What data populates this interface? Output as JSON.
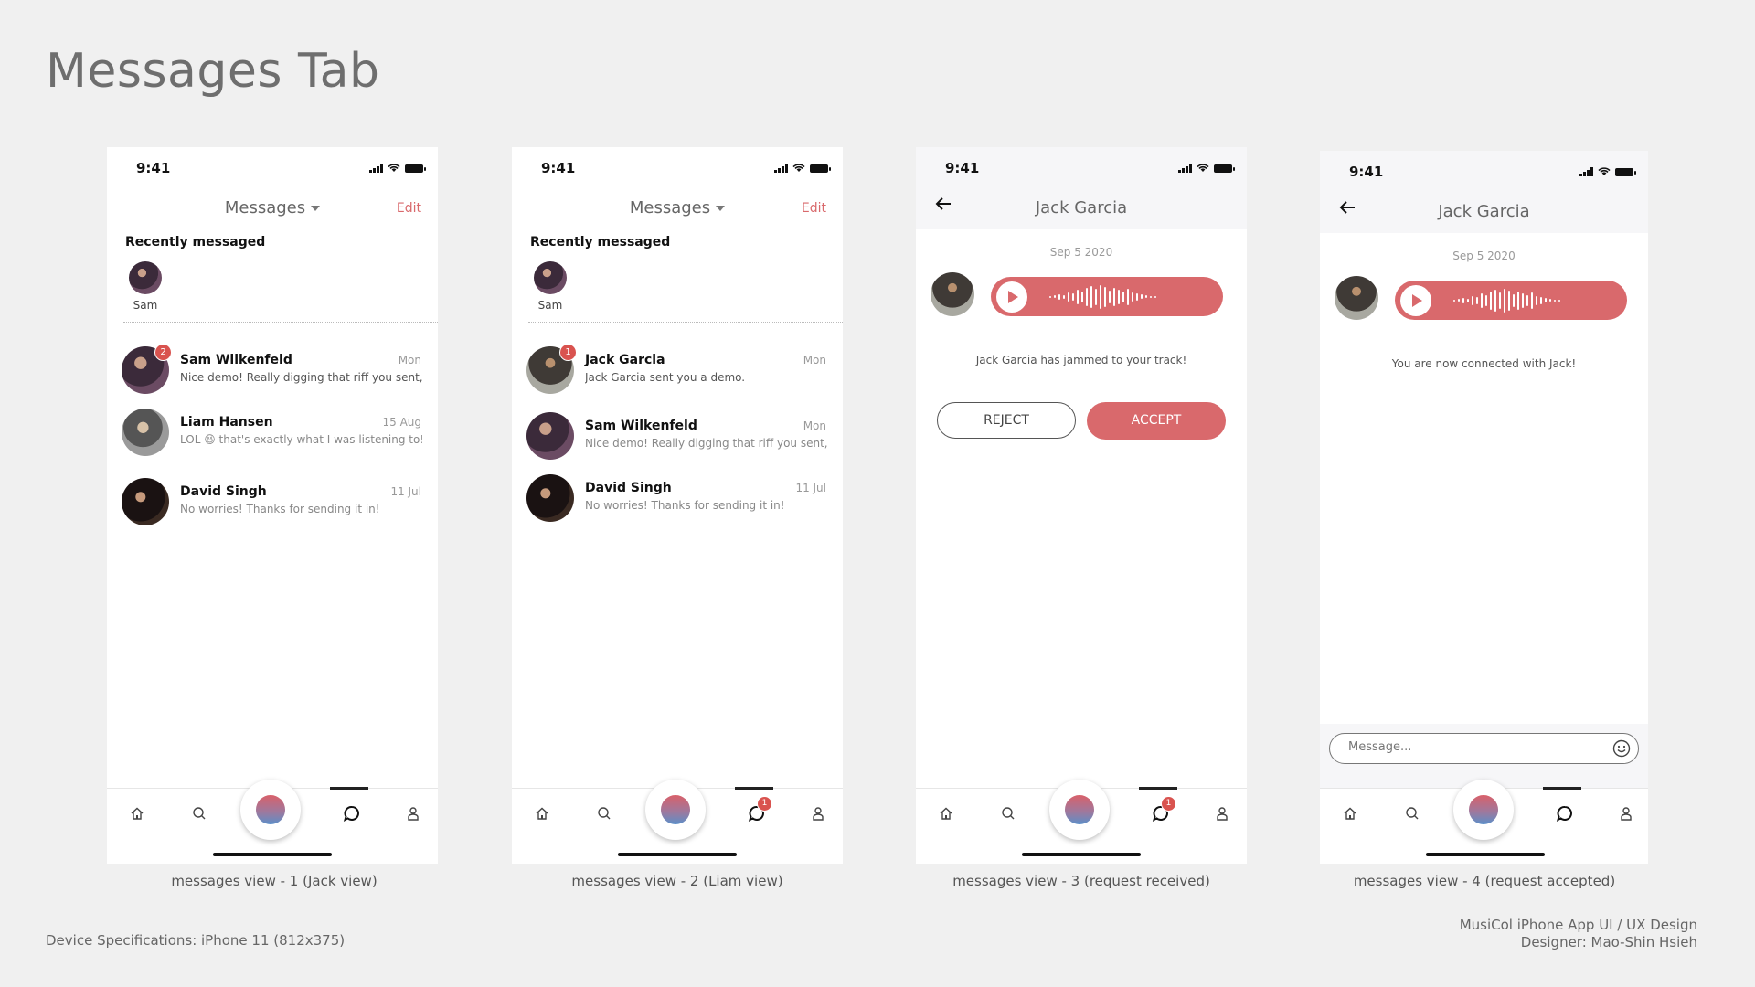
{
  "page_title": "Messages Tab",
  "status_time": "9:41",
  "footer": {
    "device_spec": "Device Specifications: iPhone 11 (812x375)",
    "project": "MusiCol iPhone App UI / UX Design",
    "designer": "Designer: Mao-Shin Hsieh"
  },
  "screens": [
    {
      "caption": "messages view - 1 (Jack view)",
      "header_title": "Messages",
      "edit_label": "Edit",
      "recent_label": "Recently messaged",
      "recent_name": "Sam",
      "conversations": [
        {
          "name": "Sam Wilkenfeld",
          "date": "Mon",
          "preview": "Nice demo! Really digging that riff you sent, I...",
          "badge": "2"
        },
        {
          "name": "Liam Hansen",
          "date": "15 Aug",
          "preview": "LOL 😆 that's exactly what I was listening to!!"
        },
        {
          "name": "David Singh",
          "date": "11 Jul",
          "preview": "No worries! Thanks for sending it in!"
        }
      ]
    },
    {
      "caption": "messages view - 2 (Liam view)",
      "header_title": "Messages",
      "edit_label": "Edit",
      "recent_label": "Recently messaged",
      "recent_name": "Sam",
      "tab_badge": "1",
      "conversations": [
        {
          "name": "Jack Garcia",
          "date": "Mon",
          "preview": "Jack Garcia sent you a demo.",
          "badge": "1"
        },
        {
          "name": "Sam Wilkenfeld",
          "date": "Mon",
          "preview": "Nice demo! Really digging that riff you sent, I..."
        },
        {
          "name": "David Singh",
          "date": "11 Jul",
          "preview": "No worries! Thanks for sending it in!"
        }
      ]
    },
    {
      "caption": "messages view - 3 (request received)",
      "chat_title": "Jack Garcia",
      "date": "Sep 5 2020",
      "note": "Jack Garcia has jammed to your track!",
      "reject_label": "REJECT",
      "accept_label": "ACCEPT",
      "tab_badge": "1"
    },
    {
      "caption": "messages view - 4 (request accepted)",
      "chat_title": "Jack Garcia",
      "date": "Sep 5 2020",
      "note": "You are now connected with Jack!",
      "input_placeholder": "Message..."
    }
  ],
  "colors": {
    "accent": "#d9696c",
    "badge": "#d9534f",
    "background": "#f0f0f0"
  },
  "icons": [
    "home-icon",
    "search-icon",
    "chat-bubble-icon",
    "profile-icon",
    "back-arrow-icon",
    "play-icon",
    "emoji-icon",
    "caret-down-icon"
  ]
}
